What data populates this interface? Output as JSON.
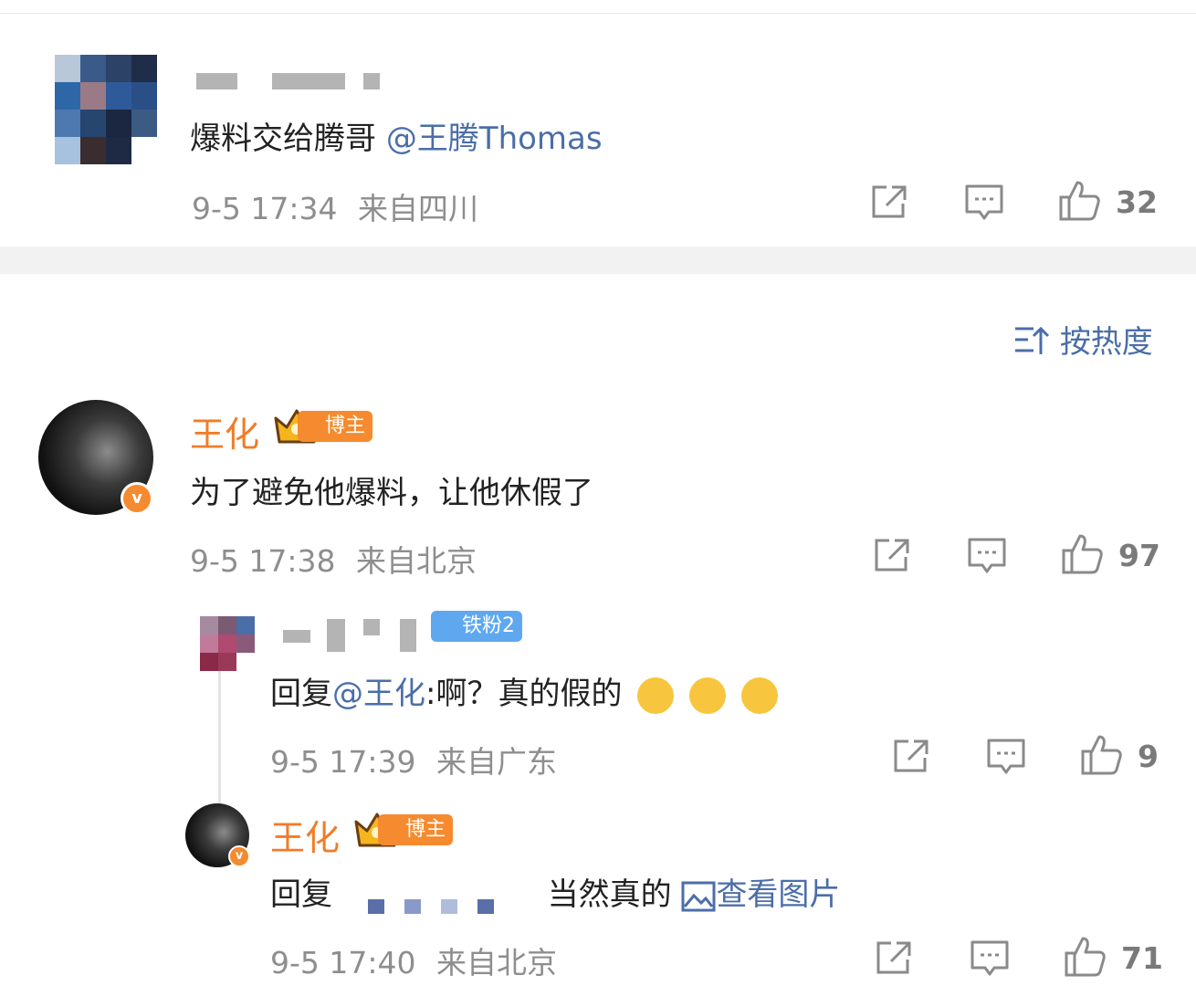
{
  "top_comment": {
    "text": "爆料交给腾哥",
    "mention": "@王腾Thomas",
    "time": "9-5 17:34",
    "location": "来自四川",
    "likes": "32"
  },
  "sort": {
    "label": "按热度"
  },
  "main_comment": {
    "author": "王化",
    "badge": "博主",
    "text": "为了避免他爆料，让他休假了",
    "time": "9-5 17:38",
    "location": "来自北京",
    "likes": "97"
  },
  "reply1": {
    "badge": "铁粉2",
    "prefix": "回复",
    "mention": "@王化",
    "text": ":啊？真的假的",
    "time": "9-5 17:39",
    "location": "来自广东",
    "likes": "9"
  },
  "reply2": {
    "author": "王化",
    "badge": "博主",
    "prefix": "回复",
    "text": "当然真的",
    "view_image": "查看图片",
    "time": "9-5 17:40",
    "location": "来自北京",
    "likes": "71"
  },
  "icons": {
    "share": "share-icon",
    "comment": "comment-icon",
    "like": "thumbs-up-icon",
    "sort": "sort-icon",
    "verified": "verified-v-icon",
    "crown": "crown-icon",
    "diamond": "diamond-icon",
    "emoji": "grinning-emoji-icon",
    "image": "image-icon"
  },
  "colors": {
    "accent_orange": "#f07c28",
    "link_blue": "#4b6ea8",
    "fan_badge_blue": "#5fa8f0",
    "meta_gray": "#8e8e8e"
  }
}
